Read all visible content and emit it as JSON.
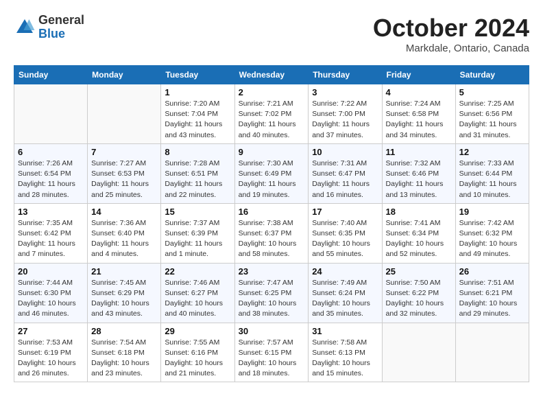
{
  "header": {
    "logo_general": "General",
    "logo_blue": "Blue",
    "month_title": "October 2024",
    "location": "Markdale, Ontario, Canada"
  },
  "weekdays": [
    "Sunday",
    "Monday",
    "Tuesday",
    "Wednesday",
    "Thursday",
    "Friday",
    "Saturday"
  ],
  "weeks": [
    [
      {
        "day": "",
        "info": ""
      },
      {
        "day": "",
        "info": ""
      },
      {
        "day": "1",
        "info": "Sunrise: 7:20 AM\nSunset: 7:04 PM\nDaylight: 11 hours and 43 minutes."
      },
      {
        "day": "2",
        "info": "Sunrise: 7:21 AM\nSunset: 7:02 PM\nDaylight: 11 hours and 40 minutes."
      },
      {
        "day": "3",
        "info": "Sunrise: 7:22 AM\nSunset: 7:00 PM\nDaylight: 11 hours and 37 minutes."
      },
      {
        "day": "4",
        "info": "Sunrise: 7:24 AM\nSunset: 6:58 PM\nDaylight: 11 hours and 34 minutes."
      },
      {
        "day": "5",
        "info": "Sunrise: 7:25 AM\nSunset: 6:56 PM\nDaylight: 11 hours and 31 minutes."
      }
    ],
    [
      {
        "day": "6",
        "info": "Sunrise: 7:26 AM\nSunset: 6:54 PM\nDaylight: 11 hours and 28 minutes."
      },
      {
        "day": "7",
        "info": "Sunrise: 7:27 AM\nSunset: 6:53 PM\nDaylight: 11 hours and 25 minutes."
      },
      {
        "day": "8",
        "info": "Sunrise: 7:28 AM\nSunset: 6:51 PM\nDaylight: 11 hours and 22 minutes."
      },
      {
        "day": "9",
        "info": "Sunrise: 7:30 AM\nSunset: 6:49 PM\nDaylight: 11 hours and 19 minutes."
      },
      {
        "day": "10",
        "info": "Sunrise: 7:31 AM\nSunset: 6:47 PM\nDaylight: 11 hours and 16 minutes."
      },
      {
        "day": "11",
        "info": "Sunrise: 7:32 AM\nSunset: 6:46 PM\nDaylight: 11 hours and 13 minutes."
      },
      {
        "day": "12",
        "info": "Sunrise: 7:33 AM\nSunset: 6:44 PM\nDaylight: 11 hours and 10 minutes."
      }
    ],
    [
      {
        "day": "13",
        "info": "Sunrise: 7:35 AM\nSunset: 6:42 PM\nDaylight: 11 hours and 7 minutes."
      },
      {
        "day": "14",
        "info": "Sunrise: 7:36 AM\nSunset: 6:40 PM\nDaylight: 11 hours and 4 minutes."
      },
      {
        "day": "15",
        "info": "Sunrise: 7:37 AM\nSunset: 6:39 PM\nDaylight: 11 hours and 1 minute."
      },
      {
        "day": "16",
        "info": "Sunrise: 7:38 AM\nSunset: 6:37 PM\nDaylight: 10 hours and 58 minutes."
      },
      {
        "day": "17",
        "info": "Sunrise: 7:40 AM\nSunset: 6:35 PM\nDaylight: 10 hours and 55 minutes."
      },
      {
        "day": "18",
        "info": "Sunrise: 7:41 AM\nSunset: 6:34 PM\nDaylight: 10 hours and 52 minutes."
      },
      {
        "day": "19",
        "info": "Sunrise: 7:42 AM\nSunset: 6:32 PM\nDaylight: 10 hours and 49 minutes."
      }
    ],
    [
      {
        "day": "20",
        "info": "Sunrise: 7:44 AM\nSunset: 6:30 PM\nDaylight: 10 hours and 46 minutes."
      },
      {
        "day": "21",
        "info": "Sunrise: 7:45 AM\nSunset: 6:29 PM\nDaylight: 10 hours and 43 minutes."
      },
      {
        "day": "22",
        "info": "Sunrise: 7:46 AM\nSunset: 6:27 PM\nDaylight: 10 hours and 40 minutes."
      },
      {
        "day": "23",
        "info": "Sunrise: 7:47 AM\nSunset: 6:25 PM\nDaylight: 10 hours and 38 minutes."
      },
      {
        "day": "24",
        "info": "Sunrise: 7:49 AM\nSunset: 6:24 PM\nDaylight: 10 hours and 35 minutes."
      },
      {
        "day": "25",
        "info": "Sunrise: 7:50 AM\nSunset: 6:22 PM\nDaylight: 10 hours and 32 minutes."
      },
      {
        "day": "26",
        "info": "Sunrise: 7:51 AM\nSunset: 6:21 PM\nDaylight: 10 hours and 29 minutes."
      }
    ],
    [
      {
        "day": "27",
        "info": "Sunrise: 7:53 AM\nSunset: 6:19 PM\nDaylight: 10 hours and 26 minutes."
      },
      {
        "day": "28",
        "info": "Sunrise: 7:54 AM\nSunset: 6:18 PM\nDaylight: 10 hours and 23 minutes."
      },
      {
        "day": "29",
        "info": "Sunrise: 7:55 AM\nSunset: 6:16 PM\nDaylight: 10 hours and 21 minutes."
      },
      {
        "day": "30",
        "info": "Sunrise: 7:57 AM\nSunset: 6:15 PM\nDaylight: 10 hours and 18 minutes."
      },
      {
        "day": "31",
        "info": "Sunrise: 7:58 AM\nSunset: 6:13 PM\nDaylight: 10 hours and 15 minutes."
      },
      {
        "day": "",
        "info": ""
      },
      {
        "day": "",
        "info": ""
      }
    ]
  ]
}
